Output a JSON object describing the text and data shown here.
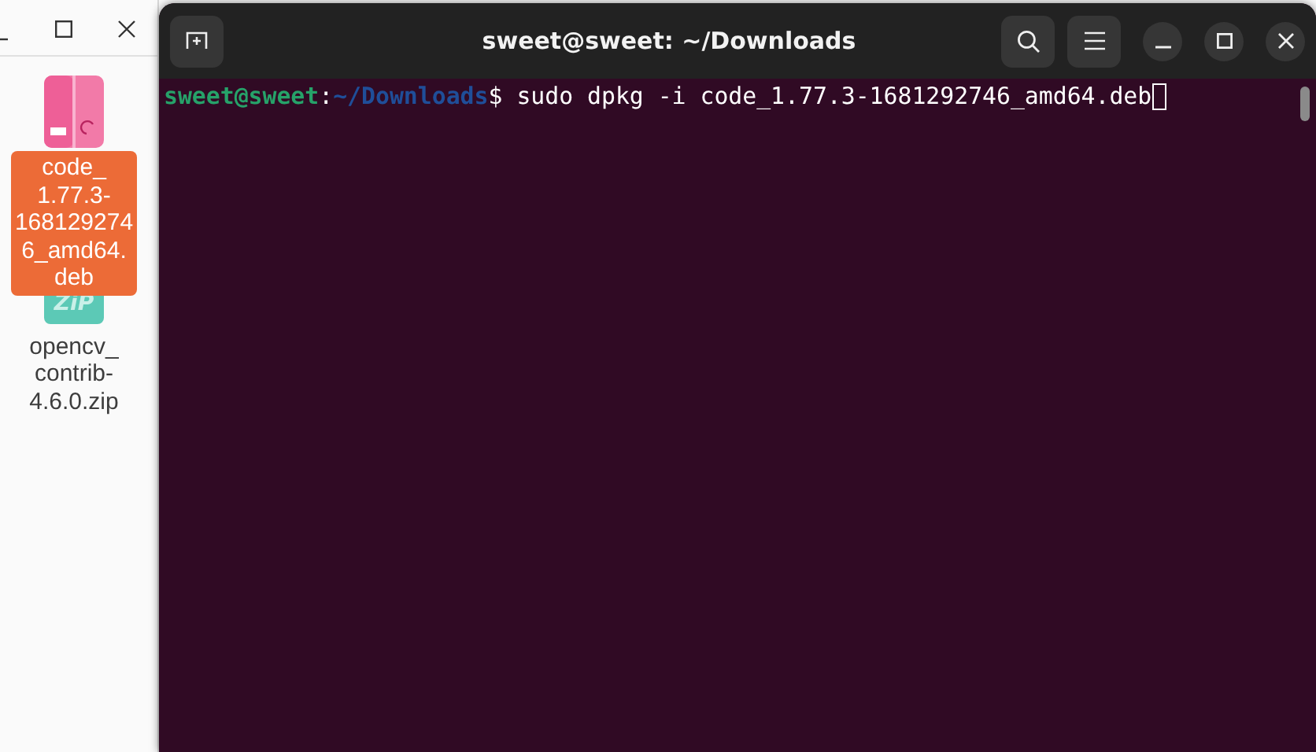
{
  "file_manager": {
    "files": [
      {
        "kind": "deb",
        "name": "code_\n1.77.3-\n168129274\n6_amd64.\ndeb",
        "selected": true
      },
      {
        "kind": "zip",
        "badge": "ZiP",
        "name": "opencv_\ncontrib-\n4.6.0.zip",
        "selected": false
      }
    ]
  },
  "terminal": {
    "title": "sweet@sweet: ~/Downloads",
    "prompt": {
      "user_host": "sweet@sweet",
      "separator": ":",
      "path": "~/Downloads",
      "symbol": "$"
    },
    "command": "sudo dpkg -i code_1.77.3-1681292746_amd64.deb"
  }
}
